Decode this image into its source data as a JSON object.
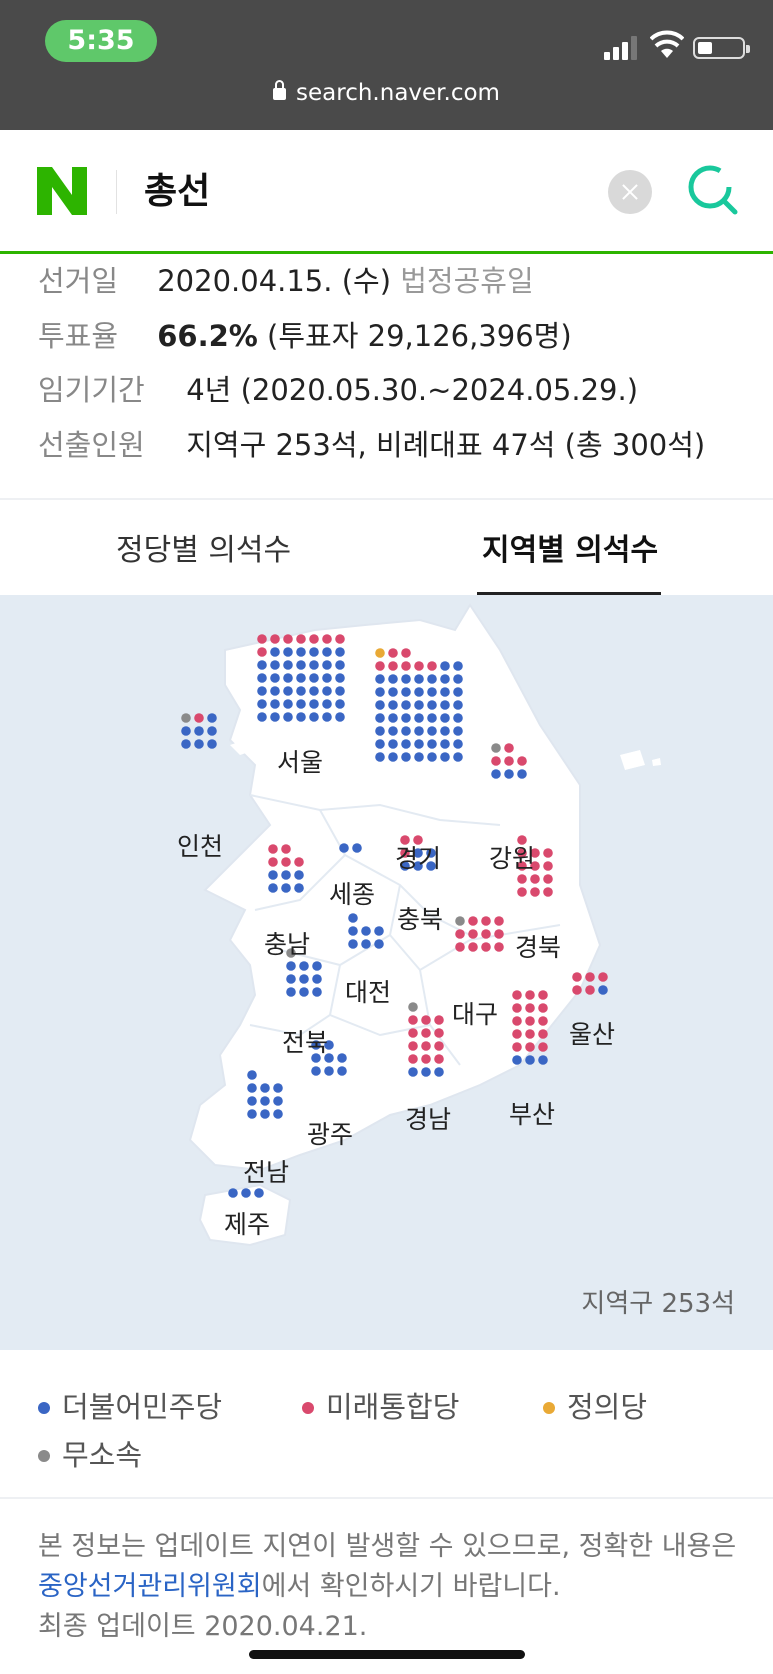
{
  "status_bar": {
    "time": "5:35",
    "url": "search.naver.com"
  },
  "search": {
    "logo": "N",
    "query": "총선"
  },
  "info": {
    "election_day": {
      "label": "선거일",
      "value": "2020.04.15. (수)",
      "note": "법정공휴일"
    },
    "turnout": {
      "label": "투표율",
      "value": "66.2%",
      "note": "(투표자 29,126,396명)"
    },
    "term": {
      "label": "임기기간",
      "value": "4년 (2020.05.30.~2024.05.29.)"
    },
    "seats": {
      "label": "선출인원",
      "value": "지역구 253석, 비례대표 47석 (총 300석)"
    }
  },
  "tabs": [
    {
      "label": "정당별 의석수",
      "active": false
    },
    {
      "label": "지역별 의석수",
      "active": true
    }
  ],
  "map": {
    "total_label": "지역구 253석",
    "regions": [
      {
        "name": "서울",
        "blue": 41,
        "red": 8,
        "yellow": 0,
        "gray": 0
      },
      {
        "name": "경기",
        "blue": 51,
        "red": 7,
        "yellow": 1,
        "gray": 0
      },
      {
        "name": "인천",
        "blue": 7,
        "red": 1,
        "yellow": 0,
        "gray": 1
      },
      {
        "name": "강원",
        "blue": 3,
        "red": 4,
        "yellow": 0,
        "gray": 1
      },
      {
        "name": "충남",
        "blue": 6,
        "red": 5,
        "yellow": 0,
        "gray": 0
      },
      {
        "name": "세종",
        "blue": 2,
        "red": 0,
        "yellow": 0,
        "gray": 0
      },
      {
        "name": "충북",
        "blue": 5,
        "red": 3,
        "yellow": 0,
        "gray": 0
      },
      {
        "name": "경북",
        "blue": 0,
        "red": 13,
        "yellow": 0,
        "gray": 0
      },
      {
        "name": "대전",
        "blue": 7,
        "red": 0,
        "yellow": 0,
        "gray": 0
      },
      {
        "name": "대구",
        "blue": 0,
        "red": 11,
        "yellow": 0,
        "gray": 1
      },
      {
        "name": "울산",
        "blue": 1,
        "red": 5,
        "yellow": 0,
        "gray": 0
      },
      {
        "name": "전북",
        "blue": 9,
        "red": 0,
        "yellow": 0,
        "gray": 1
      },
      {
        "name": "경남",
        "blue": 3,
        "red": 12,
        "yellow": 0,
        "gray": 1
      },
      {
        "name": "부산",
        "blue": 3,
        "red": 15,
        "yellow": 0,
        "gray": 0
      },
      {
        "name": "광주",
        "blue": 8,
        "red": 0,
        "yellow": 0,
        "gray": 0
      },
      {
        "name": "전남",
        "blue": 10,
        "red": 0,
        "yellow": 0,
        "gray": 0
      },
      {
        "name": "제주",
        "blue": 3,
        "red": 0,
        "yellow": 0,
        "gray": 0
      }
    ]
  },
  "legend": [
    {
      "label": "더불어민주당",
      "color": "#3a66c4"
    },
    {
      "label": "미래통합당",
      "color": "#d9496d"
    },
    {
      "label": "정의당",
      "color": "#e9a935"
    },
    {
      "label": "무소속",
      "color": "#8a8a8a"
    }
  ],
  "notice": {
    "text_before": "본 정보는 업데이트 지연이 발생할 수 있으므로, 정확한 내용은 ",
    "link": "중앙선거관리위원회",
    "text_after": "에서 확인하시기 바랍니다.",
    "updated": "최종 업데이트 2020.04.21."
  }
}
